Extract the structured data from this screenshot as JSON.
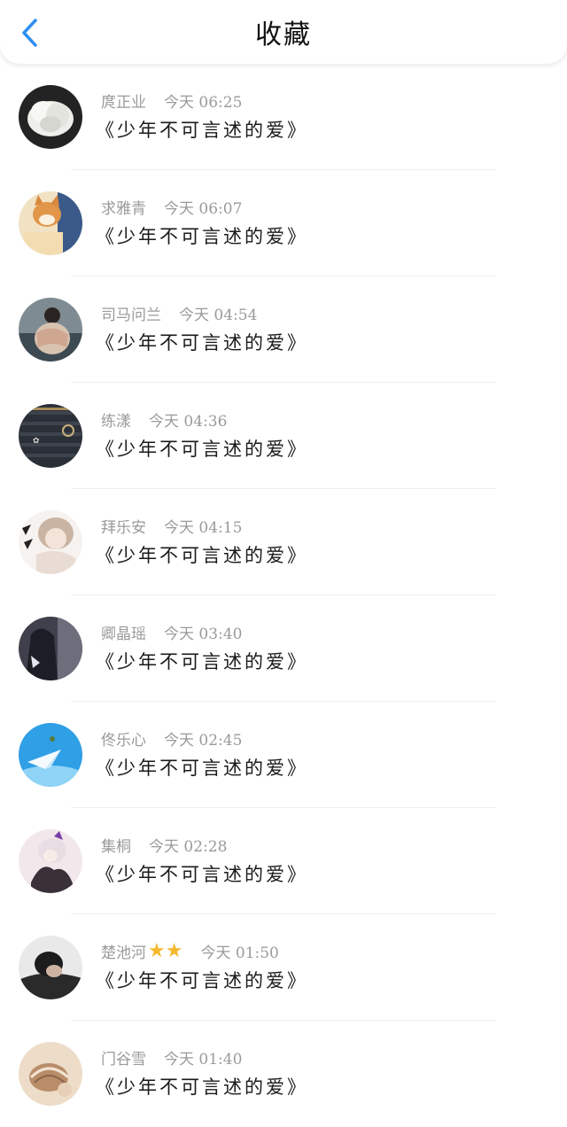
{
  "header": {
    "title": "收藏",
    "back_icon": "chevron-left-icon",
    "accent_color": "#2f8ff0"
  },
  "items": [
    {
      "author": "庹正业",
      "time": "今天 06:25",
      "book": "《少年不可言述的爱》",
      "stars": 0,
      "avatar_icon": "white-flower-avatar"
    },
    {
      "author": "求雅青",
      "time": "今天 06:07",
      "book": "《少年不可言述的爱》",
      "stars": 0,
      "avatar_icon": "cat-avatar"
    },
    {
      "author": "司马问兰",
      "time": "今天 04:54",
      "book": "《少年不可言述的爱》",
      "stars": 0,
      "avatar_icon": "person-photo-avatar"
    },
    {
      "author": "练漾",
      "time": "今天 04:36",
      "book": "《少年不可言述的爱》",
      "stars": 0,
      "avatar_icon": "dark-knit-avatar"
    },
    {
      "author": "拜乐安",
      "time": "今天 04:15",
      "book": "《少年不可言述的爱》",
      "stars": 0,
      "avatar_icon": "anime-girl-avatar"
    },
    {
      "author": "卿晶瑶",
      "time": "今天 03:40",
      "book": "《少年不可言述的爱》",
      "stars": 0,
      "avatar_icon": "dark-portrait-avatar"
    },
    {
      "author": "佟乐心",
      "time": "今天 02:45",
      "book": "《少年不可言述的爱》",
      "stars": 0,
      "avatar_icon": "blue-sky-avatar"
    },
    {
      "author": "集桐",
      "time": "今天 02:28",
      "book": "《少年不可言述的爱》",
      "stars": 0,
      "avatar_icon": "anime-character-avatar"
    },
    {
      "author": "楚池河",
      "time": "今天 01:50",
      "book": "《少年不可言述的爱》",
      "stars": 2,
      "avatar_icon": "boy-photo-avatar"
    },
    {
      "author": "门谷雪",
      "time": "今天 01:40",
      "book": "《少年不可言述的爱》",
      "stars": 0,
      "avatar_icon": "seashell-avatar"
    }
  ]
}
